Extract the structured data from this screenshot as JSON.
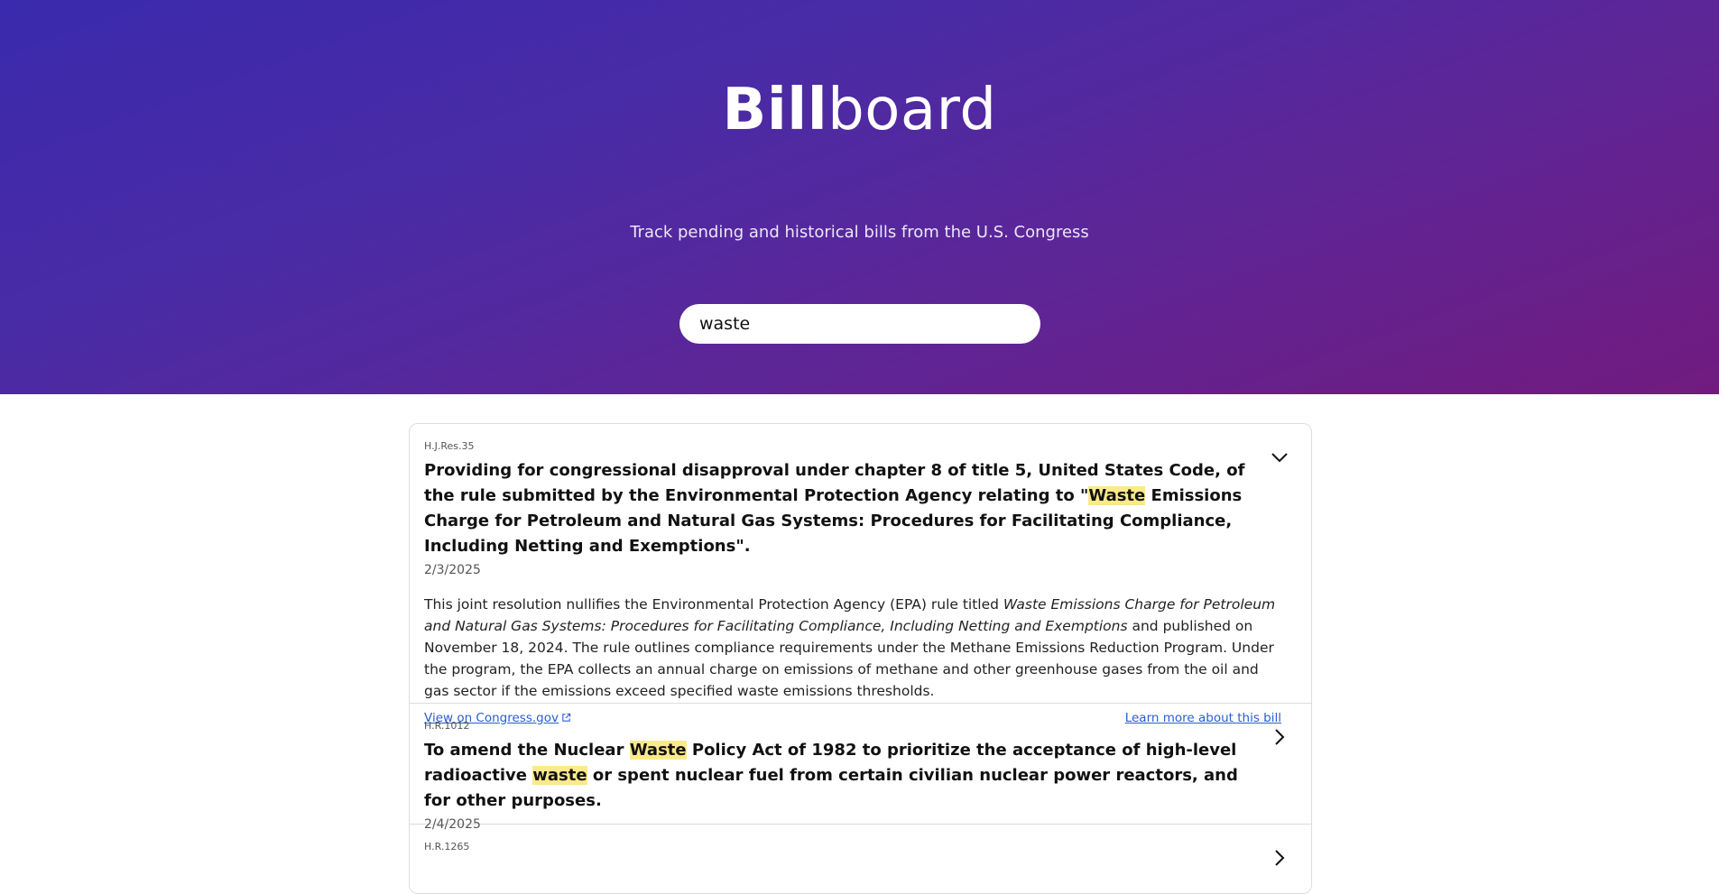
{
  "brand": {
    "bold": "Bill",
    "light": "board"
  },
  "tagline": "Track pending and historical bills from the U.S. Congress",
  "search": {
    "value": "waste"
  },
  "results": [
    {
      "id": "H.J.Res.35",
      "title_parts": [
        "Providing for congressional disapproval under chapter 8 of title 5, United States Code, of the rule submitted by the Environmental Protection Agency relating to \"",
        "Waste",
        " Emissions Charge for Petroleum and Natural Gas Systems: Procedures for Facilitating Compliance, Including Netting and Exemptions\"."
      ],
      "date": "2/3/2025",
      "expanded": true,
      "summary": {
        "before": "This joint resolution nullifies the Environmental Protection Agency (EPA) rule titled ",
        "italic": "Waste Emissions Charge for Petroleum and Natural Gas Systems: Procedures for Facilitating Compliance, Including Netting and Exemptions",
        "after": " and published on November 18, 2024. The rule outlines compliance requirements under the Methane Emissions Reduction Program. Under the program, the EPA collects an annual charge on emissions of methane and other greenhouse gases from the oil and gas sector if the emissions exceed specified waste emissions thresholds."
      },
      "link_congress": "View on Congress.gov",
      "link_learn": "Learn more about this bill"
    },
    {
      "id": "H.R.1012",
      "title_parts": [
        "To amend the Nuclear ",
        "Waste",
        " Policy Act of 1982 to prioritize the acceptance of high-level radioactive ",
        "waste",
        " or spent nuclear fuel from certain civilian nuclear power reactors, and for other purposes."
      ],
      "date": "2/4/2025",
      "expanded": false
    },
    {
      "id": "H.R.1265",
      "expanded": false
    }
  ],
  "colors": {
    "highlight": "#fbe98a",
    "link": "#2a5bd7",
    "hero_start": "#3a2aad",
    "hero_end": "#711b7f"
  }
}
